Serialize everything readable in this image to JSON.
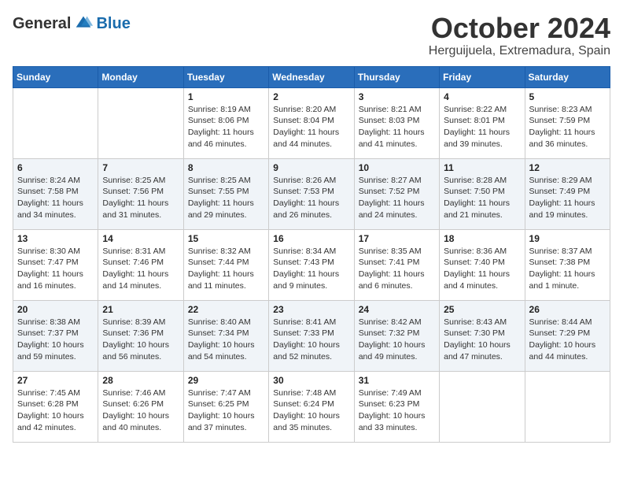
{
  "header": {
    "logo": {
      "general": "General",
      "blue": "Blue"
    },
    "title": "October 2024",
    "location": "Herguijuela, Extremadura, Spain"
  },
  "calendar": {
    "weekdays": [
      "Sunday",
      "Monday",
      "Tuesday",
      "Wednesday",
      "Thursday",
      "Friday",
      "Saturday"
    ],
    "weeks": [
      [
        {
          "day": null,
          "sunrise": null,
          "sunset": null,
          "daylight": null
        },
        {
          "day": null,
          "sunrise": null,
          "sunset": null,
          "daylight": null
        },
        {
          "day": "1",
          "sunrise": "Sunrise: 8:19 AM",
          "sunset": "Sunset: 8:06 PM",
          "daylight": "Daylight: 11 hours and 46 minutes."
        },
        {
          "day": "2",
          "sunrise": "Sunrise: 8:20 AM",
          "sunset": "Sunset: 8:04 PM",
          "daylight": "Daylight: 11 hours and 44 minutes."
        },
        {
          "day": "3",
          "sunrise": "Sunrise: 8:21 AM",
          "sunset": "Sunset: 8:03 PM",
          "daylight": "Daylight: 11 hours and 41 minutes."
        },
        {
          "day": "4",
          "sunrise": "Sunrise: 8:22 AM",
          "sunset": "Sunset: 8:01 PM",
          "daylight": "Daylight: 11 hours and 39 minutes."
        },
        {
          "day": "5",
          "sunrise": "Sunrise: 8:23 AM",
          "sunset": "Sunset: 7:59 PM",
          "daylight": "Daylight: 11 hours and 36 minutes."
        }
      ],
      [
        {
          "day": "6",
          "sunrise": "Sunrise: 8:24 AM",
          "sunset": "Sunset: 7:58 PM",
          "daylight": "Daylight: 11 hours and 34 minutes."
        },
        {
          "day": "7",
          "sunrise": "Sunrise: 8:25 AM",
          "sunset": "Sunset: 7:56 PM",
          "daylight": "Daylight: 11 hours and 31 minutes."
        },
        {
          "day": "8",
          "sunrise": "Sunrise: 8:25 AM",
          "sunset": "Sunset: 7:55 PM",
          "daylight": "Daylight: 11 hours and 29 minutes."
        },
        {
          "day": "9",
          "sunrise": "Sunrise: 8:26 AM",
          "sunset": "Sunset: 7:53 PM",
          "daylight": "Daylight: 11 hours and 26 minutes."
        },
        {
          "day": "10",
          "sunrise": "Sunrise: 8:27 AM",
          "sunset": "Sunset: 7:52 PM",
          "daylight": "Daylight: 11 hours and 24 minutes."
        },
        {
          "day": "11",
          "sunrise": "Sunrise: 8:28 AM",
          "sunset": "Sunset: 7:50 PM",
          "daylight": "Daylight: 11 hours and 21 minutes."
        },
        {
          "day": "12",
          "sunrise": "Sunrise: 8:29 AM",
          "sunset": "Sunset: 7:49 PM",
          "daylight": "Daylight: 11 hours and 19 minutes."
        }
      ],
      [
        {
          "day": "13",
          "sunrise": "Sunrise: 8:30 AM",
          "sunset": "Sunset: 7:47 PM",
          "daylight": "Daylight: 11 hours and 16 minutes."
        },
        {
          "day": "14",
          "sunrise": "Sunrise: 8:31 AM",
          "sunset": "Sunset: 7:46 PM",
          "daylight": "Daylight: 11 hours and 14 minutes."
        },
        {
          "day": "15",
          "sunrise": "Sunrise: 8:32 AM",
          "sunset": "Sunset: 7:44 PM",
          "daylight": "Daylight: 11 hours and 11 minutes."
        },
        {
          "day": "16",
          "sunrise": "Sunrise: 8:34 AM",
          "sunset": "Sunset: 7:43 PM",
          "daylight": "Daylight: 11 hours and 9 minutes."
        },
        {
          "day": "17",
          "sunrise": "Sunrise: 8:35 AM",
          "sunset": "Sunset: 7:41 PM",
          "daylight": "Daylight: 11 hours and 6 minutes."
        },
        {
          "day": "18",
          "sunrise": "Sunrise: 8:36 AM",
          "sunset": "Sunset: 7:40 PM",
          "daylight": "Daylight: 11 hours and 4 minutes."
        },
        {
          "day": "19",
          "sunrise": "Sunrise: 8:37 AM",
          "sunset": "Sunset: 7:38 PM",
          "daylight": "Daylight: 11 hours and 1 minute."
        }
      ],
      [
        {
          "day": "20",
          "sunrise": "Sunrise: 8:38 AM",
          "sunset": "Sunset: 7:37 PM",
          "daylight": "Daylight: 10 hours and 59 minutes."
        },
        {
          "day": "21",
          "sunrise": "Sunrise: 8:39 AM",
          "sunset": "Sunset: 7:36 PM",
          "daylight": "Daylight: 10 hours and 56 minutes."
        },
        {
          "day": "22",
          "sunrise": "Sunrise: 8:40 AM",
          "sunset": "Sunset: 7:34 PM",
          "daylight": "Daylight: 10 hours and 54 minutes."
        },
        {
          "day": "23",
          "sunrise": "Sunrise: 8:41 AM",
          "sunset": "Sunset: 7:33 PM",
          "daylight": "Daylight: 10 hours and 52 minutes."
        },
        {
          "day": "24",
          "sunrise": "Sunrise: 8:42 AM",
          "sunset": "Sunset: 7:32 PM",
          "daylight": "Daylight: 10 hours and 49 minutes."
        },
        {
          "day": "25",
          "sunrise": "Sunrise: 8:43 AM",
          "sunset": "Sunset: 7:30 PM",
          "daylight": "Daylight: 10 hours and 47 minutes."
        },
        {
          "day": "26",
          "sunrise": "Sunrise: 8:44 AM",
          "sunset": "Sunset: 7:29 PM",
          "daylight": "Daylight: 10 hours and 44 minutes."
        }
      ],
      [
        {
          "day": "27",
          "sunrise": "Sunrise: 7:45 AM",
          "sunset": "Sunset: 6:28 PM",
          "daylight": "Daylight: 10 hours and 42 minutes."
        },
        {
          "day": "28",
          "sunrise": "Sunrise: 7:46 AM",
          "sunset": "Sunset: 6:26 PM",
          "daylight": "Daylight: 10 hours and 40 minutes."
        },
        {
          "day": "29",
          "sunrise": "Sunrise: 7:47 AM",
          "sunset": "Sunset: 6:25 PM",
          "daylight": "Daylight: 10 hours and 37 minutes."
        },
        {
          "day": "30",
          "sunrise": "Sunrise: 7:48 AM",
          "sunset": "Sunset: 6:24 PM",
          "daylight": "Daylight: 10 hours and 35 minutes."
        },
        {
          "day": "31",
          "sunrise": "Sunrise: 7:49 AM",
          "sunset": "Sunset: 6:23 PM",
          "daylight": "Daylight: 10 hours and 33 minutes."
        },
        {
          "day": null,
          "sunrise": null,
          "sunset": null,
          "daylight": null
        },
        {
          "day": null,
          "sunrise": null,
          "sunset": null,
          "daylight": null
        }
      ]
    ]
  }
}
